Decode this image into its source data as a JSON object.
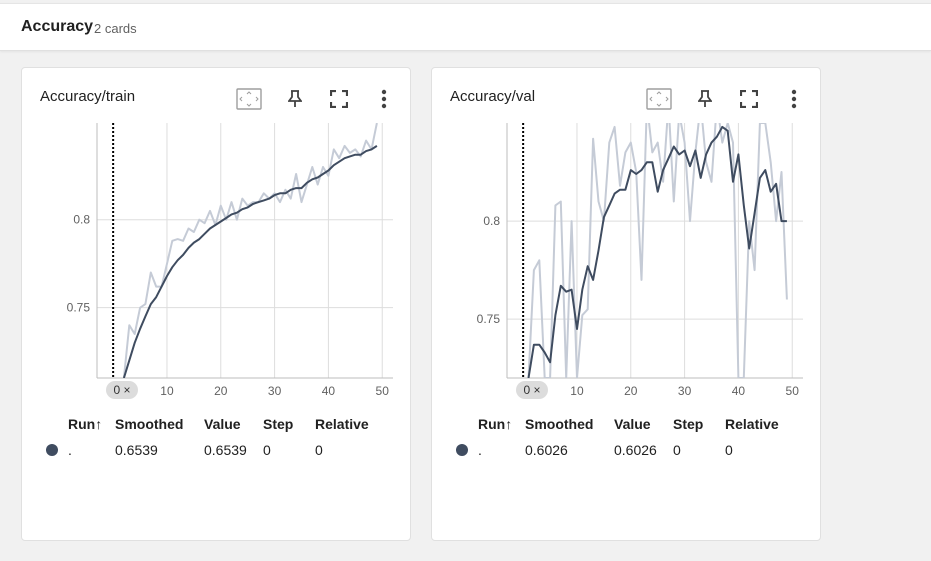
{
  "group": {
    "title": "Accuracy",
    "count": "2 cards"
  },
  "cards": [
    {
      "title": "Accuracy/train",
      "y_ticks": [
        "0.8",
        "0.75"
      ],
      "x_ticks": [
        "10",
        "20",
        "30",
        "40",
        "50"
      ],
      "step_badge": "0 ×",
      "legend": {
        "headers": {
          "run": "Run",
          "sort_icon": "↑",
          "smoothed": "Smoothed",
          "value": "Value",
          "step": "Step",
          "relative": "Relative"
        },
        "row": {
          "run": ".",
          "smoothed": "0.6539",
          "value": "0.6539",
          "step": "0",
          "relative": "0"
        }
      }
    },
    {
      "title": "Accuracy/val",
      "y_ticks": [
        "0.8",
        "0.75"
      ],
      "x_ticks": [
        "10",
        "20",
        "30",
        "40",
        "50"
      ],
      "step_badge": "0 ×",
      "legend": {
        "headers": {
          "run": "Run",
          "sort_icon": "↑",
          "smoothed": "Smoothed",
          "value": "Value",
          "step": "Step",
          "relative": "Relative"
        },
        "row": {
          "run": ".",
          "smoothed": "0.6026",
          "value": "0.6026",
          "step": "0",
          "relative": "0"
        }
      }
    }
  ],
  "icons": [
    "fit-domain-icon",
    "pin-icon",
    "fullscreen-icon",
    "more-vert-icon"
  ],
  "colors": {
    "smoothed": "#3f4c60",
    "raw": "#c5cbd6",
    "grid": "#dddddd"
  },
  "chart_data": [
    {
      "type": "line",
      "title": "Accuracy/train",
      "xlim": [
        -3,
        52
      ],
      "ylim": [
        0.71,
        0.855
      ],
      "x_ticks": [
        10,
        20,
        30,
        40,
        50
      ],
      "y_ticks": [
        0.75,
        0.8
      ],
      "grid": true,
      "step_marker": 0,
      "series": [
        {
          "values_x": [
            2,
            3,
            4,
            5,
            6,
            7,
            8,
            9,
            10,
            11,
            12,
            13,
            14,
            15,
            16,
            17,
            18,
            19,
            20,
            21,
            22,
            23,
            24,
            25,
            26,
            27,
            28,
            29,
            30,
            31,
            32,
            33,
            34,
            35,
            36,
            37,
            38,
            39,
            40,
            41,
            42,
            43,
            44,
            45,
            46,
            47,
            48,
            49
          ],
          "values": [
            0.71,
            0.74,
            0.735,
            0.75,
            0.752,
            0.77,
            0.762,
            0.762,
            0.775,
            0.788,
            0.789,
            0.788,
            0.795,
            0.793,
            0.8,
            0.798,
            0.805,
            0.797,
            0.808,
            0.8,
            0.81,
            0.8,
            0.812,
            0.808,
            0.81,
            0.81,
            0.815,
            0.812,
            0.815,
            0.81,
            0.817,
            0.812,
            0.826,
            0.81,
            0.82,
            0.83,
            0.82,
            0.83,
            0.825,
            0.84,
            0.835,
            0.842,
            0.838,
            0.84,
            0.836,
            0.845,
            0.84,
            0.855
          ]
        },
        {
          "values_x": [
            2,
            3,
            4,
            5,
            6,
            7,
            8,
            9,
            10,
            11,
            12,
            13,
            14,
            15,
            16,
            17,
            18,
            19,
            20,
            21,
            22,
            23,
            24,
            25,
            26,
            27,
            28,
            29,
            30,
            31,
            32,
            33,
            34,
            35,
            36,
            37,
            38,
            39,
            40,
            41,
            42,
            43,
            44,
            45,
            46,
            47,
            48,
            49
          ],
          "values": [
            0.71,
            0.72,
            0.73,
            0.738,
            0.745,
            0.752,
            0.756,
            0.762,
            0.768,
            0.773,
            0.777,
            0.78,
            0.784,
            0.787,
            0.789,
            0.792,
            0.795,
            0.797,
            0.799,
            0.801,
            0.803,
            0.804,
            0.806,
            0.807,
            0.809,
            0.81,
            0.811,
            0.812,
            0.814,
            0.815,
            0.815,
            0.817,
            0.818,
            0.818,
            0.821,
            0.823,
            0.824,
            0.826,
            0.828,
            0.831,
            0.833,
            0.835,
            0.836,
            0.837,
            0.837,
            0.839,
            0.84,
            0.842
          ]
        }
      ]
    },
    {
      "type": "line",
      "title": "Accuracy/val",
      "xlim": [
        -3,
        52
      ],
      "ylim": [
        0.72,
        0.85
      ],
      "x_ticks": [
        10,
        20,
        30,
        40,
        50
      ],
      "y_ticks": [
        0.75,
        0.8
      ],
      "grid": true,
      "step_marker": 0,
      "series": [
        {
          "values_x": [
            1,
            2,
            3,
            4,
            5,
            6,
            7,
            8,
            9,
            10,
            11,
            12,
            13,
            14,
            15,
            16,
            17,
            18,
            19,
            20,
            21,
            22,
            23,
            24,
            25,
            26,
            27,
            28,
            29,
            30,
            31,
            32,
            33,
            34,
            35,
            36,
            37,
            38,
            39,
            40,
            41,
            42,
            43,
            44,
            45,
            46,
            47,
            48,
            49
          ],
          "values": [
            0.72,
            0.775,
            0.78,
            0.72,
            0.72,
            0.808,
            0.81,
            0.72,
            0.8,
            0.72,
            0.752,
            0.755,
            0.842,
            0.81,
            0.8,
            0.84,
            0.848,
            0.818,
            0.835,
            0.84,
            0.825,
            0.77,
            0.86,
            0.835,
            0.84,
            0.82,
            0.86,
            0.81,
            0.855,
            0.84,
            0.8,
            0.835,
            0.86,
            0.83,
            0.82,
            0.86,
            0.84,
            0.85,
            0.84,
            0.72,
            0.72,
            0.8,
            0.775,
            0.85,
            0.85,
            0.83,
            0.8,
            0.825,
            0.76
          ]
        },
        {
          "values_x": [
            1,
            2,
            3,
            4,
            5,
            6,
            7,
            8,
            9,
            10,
            11,
            12,
            13,
            14,
            15,
            16,
            17,
            18,
            19,
            20,
            21,
            22,
            23,
            24,
            25,
            26,
            27,
            28,
            29,
            30,
            31,
            32,
            33,
            34,
            35,
            36,
            37,
            38,
            39,
            40,
            41,
            42,
            43,
            44,
            45,
            46,
            47,
            48,
            49
          ],
          "values": [
            0.72,
            0.737,
            0.737,
            0.733,
            0.728,
            0.752,
            0.767,
            0.764,
            0.765,
            0.745,
            0.765,
            0.777,
            0.77,
            0.785,
            0.802,
            0.808,
            0.814,
            0.816,
            0.816,
            0.826,
            0.824,
            0.826,
            0.83,
            0.83,
            0.815,
            0.826,
            0.832,
            0.838,
            0.834,
            0.836,
            0.828,
            0.836,
            0.822,
            0.834,
            0.84,
            0.843,
            0.848,
            0.846,
            0.82,
            0.834,
            0.808,
            0.786,
            0.804,
            0.822,
            0.826,
            0.815,
            0.819,
            0.8,
            0.8
          ]
        }
      ]
    }
  ]
}
